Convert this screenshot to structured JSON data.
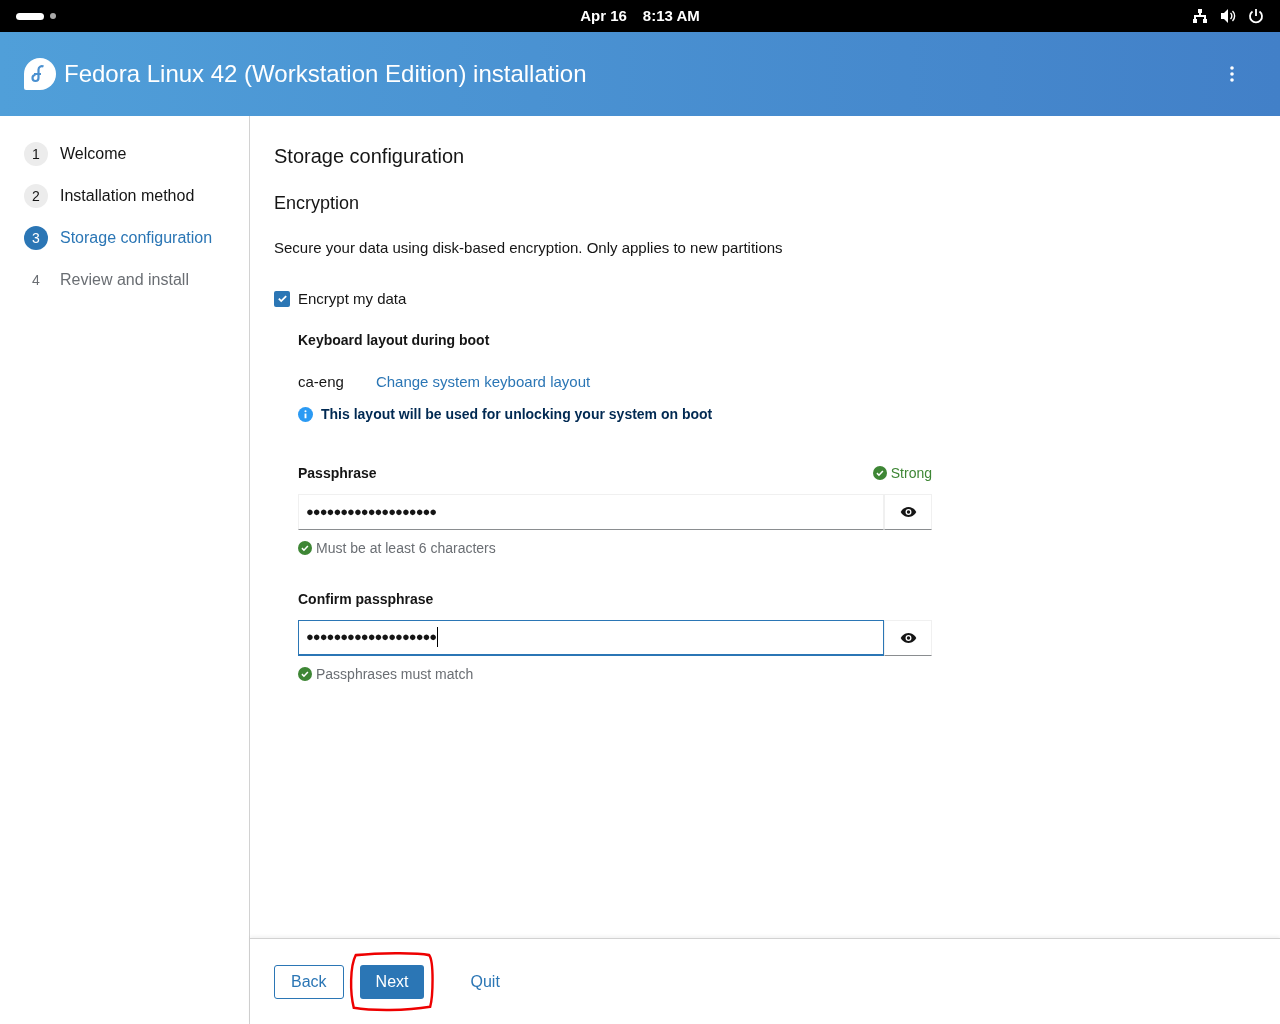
{
  "top_bar": {
    "date": "Apr 16",
    "time": "8:13 AM"
  },
  "header": {
    "title": "Fedora Linux 42 (Workstation Edition) installation"
  },
  "steps": [
    {
      "number": "1",
      "label": "Welcome",
      "selected": false,
      "disabled": false
    },
    {
      "number": "2",
      "label": "Installation method",
      "selected": false,
      "disabled": false
    },
    {
      "number": "3",
      "label": "Storage configuration",
      "selected": true,
      "disabled": false
    },
    {
      "number": "4",
      "label": "Review and install",
      "selected": false,
      "disabled": true
    }
  ],
  "page_title": "Storage configuration",
  "section_title": "Encryption",
  "description": "Secure your data using disk-based encryption. Only applies to new partitions",
  "encrypt_checkbox": {
    "label": "Encrypt my data",
    "checked": true
  },
  "keyboard": {
    "heading": "Keyboard layout during boot",
    "layout": "ca-eng",
    "link": "Change system keyboard layout",
    "info": "This layout will be used for unlocking your system on boot"
  },
  "fields": [
    {
      "label": "Passphrase",
      "value": "●●●●●●●●●●●●●●●●●●●",
      "focused": false,
      "strength": "Strong",
      "helper": "Must be at least 6 characters"
    },
    {
      "label": "Confirm passphrase",
      "value": "●●●●●●●●●●●●●●●●●●●",
      "focused": true,
      "helper": "Passphrases must match"
    }
  ],
  "buttons": [
    {
      "label": "Back",
      "kind": "secondary",
      "highlighted": false
    },
    {
      "label": "Next",
      "kind": "primary",
      "highlighted": true
    },
    {
      "label": "Quit",
      "kind": "link",
      "highlighted": false
    }
  ]
}
